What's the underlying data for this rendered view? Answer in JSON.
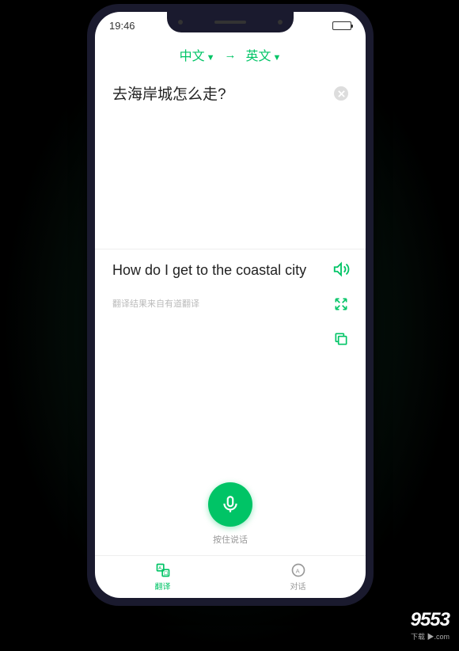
{
  "status": {
    "time": "19:46"
  },
  "lang": {
    "source": "中文",
    "target": "英文"
  },
  "input": {
    "text": "去海岸城怎么走?"
  },
  "output": {
    "text": "How do I get to the coastal city",
    "attribution": "翻译结果来自有道翻译"
  },
  "mic": {
    "label": "按住说话"
  },
  "nav": {
    "translate": "翻译",
    "dialog": "对话"
  },
  "watermark": {
    "main": "9553",
    "sub": "下载 ▶.com"
  }
}
